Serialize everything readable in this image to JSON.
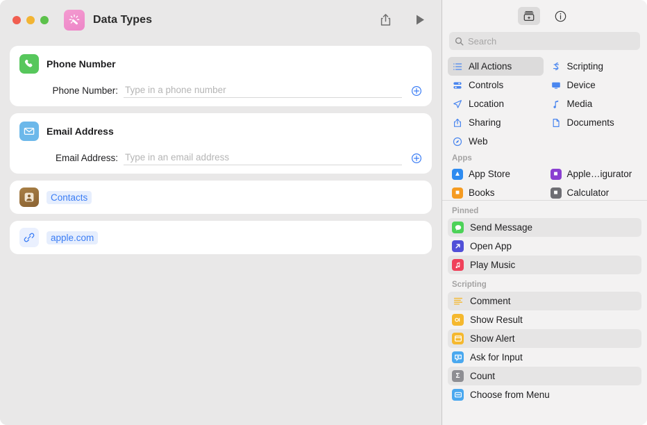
{
  "window": {
    "traffic_lights": [
      "close",
      "minimize",
      "zoom"
    ],
    "app_icon_name": "shortcuts-app-icon",
    "document_title": "Data Types",
    "toolbar": {
      "share_label": "Share",
      "run_label": "Run"
    }
  },
  "editor": {
    "cards": [
      {
        "icon": "phone-icon",
        "title": "Phone Number",
        "field_label": "Phone Number:",
        "field_value": "",
        "field_placeholder": "Type in a phone number",
        "add_label": "Add variable"
      },
      {
        "icon": "envelope-icon",
        "title": "Email Address",
        "field_label": "Email Address:",
        "field_value": "",
        "field_placeholder": "Type in an email address",
        "add_label": "Add variable"
      },
      {
        "icon": "contacts-app-icon",
        "token": "Contacts"
      },
      {
        "icon": "link-icon",
        "token": "apple.com"
      }
    ]
  },
  "sidebar": {
    "toolbar": {
      "library_label": "Action Library",
      "info_label": "Shortcut Details"
    },
    "search": {
      "value": "",
      "placeholder": "Search"
    },
    "categories_left": [
      {
        "label": "All Actions",
        "icon": "list-icon",
        "selected": true
      },
      {
        "label": "Controls",
        "icon": "controls-icon",
        "selected": false
      },
      {
        "label": "Location",
        "icon": "location-icon",
        "selected": false
      },
      {
        "label": "Sharing",
        "icon": "share-icon",
        "selected": false
      },
      {
        "label": "Web",
        "icon": "safari-icon",
        "selected": false
      }
    ],
    "categories_right": [
      {
        "label": "Scripting",
        "icon": "scripting-icon",
        "selected": false
      },
      {
        "label": "Device",
        "icon": "device-icon",
        "selected": false
      },
      {
        "label": "Media",
        "icon": "music-note-icon",
        "selected": false
      },
      {
        "label": "Documents",
        "icon": "document-icon",
        "selected": false
      }
    ],
    "apps_header": "Apps",
    "apps_left": [
      {
        "label": "App Store",
        "icon": "app-store-icon",
        "color": "#2e8bf0"
      },
      {
        "label": "Books",
        "icon": "books-icon",
        "color": "#f59b22"
      }
    ],
    "apps_right": [
      {
        "label": "Apple…igurator",
        "icon": "apple-configurator-icon",
        "color": "#8a3fd1"
      },
      {
        "label": "Calculator",
        "icon": "calculator-icon",
        "color": "#6e6e73"
      }
    ],
    "pinned_header": "Pinned",
    "pinned": [
      {
        "label": "Send Message",
        "icon": "message-bubble-icon",
        "color": "#4cd257",
        "glyph": "●",
        "alt": true
      },
      {
        "label": "Open App",
        "icon": "open-app-icon",
        "color": "#5150d8",
        "glyph": "↗",
        "alt": false
      },
      {
        "label": "Play Music",
        "icon": "music-icon",
        "color": "#f0415a",
        "glyph": "♫",
        "alt": true
      }
    ],
    "scripting_header": "Scripting",
    "scripting": [
      {
        "label": "Comment",
        "icon": "comment-icon",
        "color": "#f5b82e",
        "glyph": "≡",
        "alt": true
      },
      {
        "label": "Show Result",
        "icon": "show-result-icon",
        "color": "#f5b82e",
        "glyph": "▣",
        "alt": false
      },
      {
        "label": "Show Alert",
        "icon": "show-alert-icon",
        "color": "#f5b82e",
        "glyph": "▤",
        "alt": true
      },
      {
        "label": "Ask for Input",
        "icon": "ask-for-input-icon",
        "color": "#4aa8ef",
        "glyph": "□",
        "alt": false
      },
      {
        "label": "Count",
        "icon": "count-icon",
        "color": "#8e8e93",
        "glyph": "Σ",
        "alt": true
      },
      {
        "label": "Choose from Menu",
        "icon": "choose-from-menu-icon",
        "color": "#4aa8ef",
        "glyph": "▭",
        "alt": false
      }
    ]
  }
}
